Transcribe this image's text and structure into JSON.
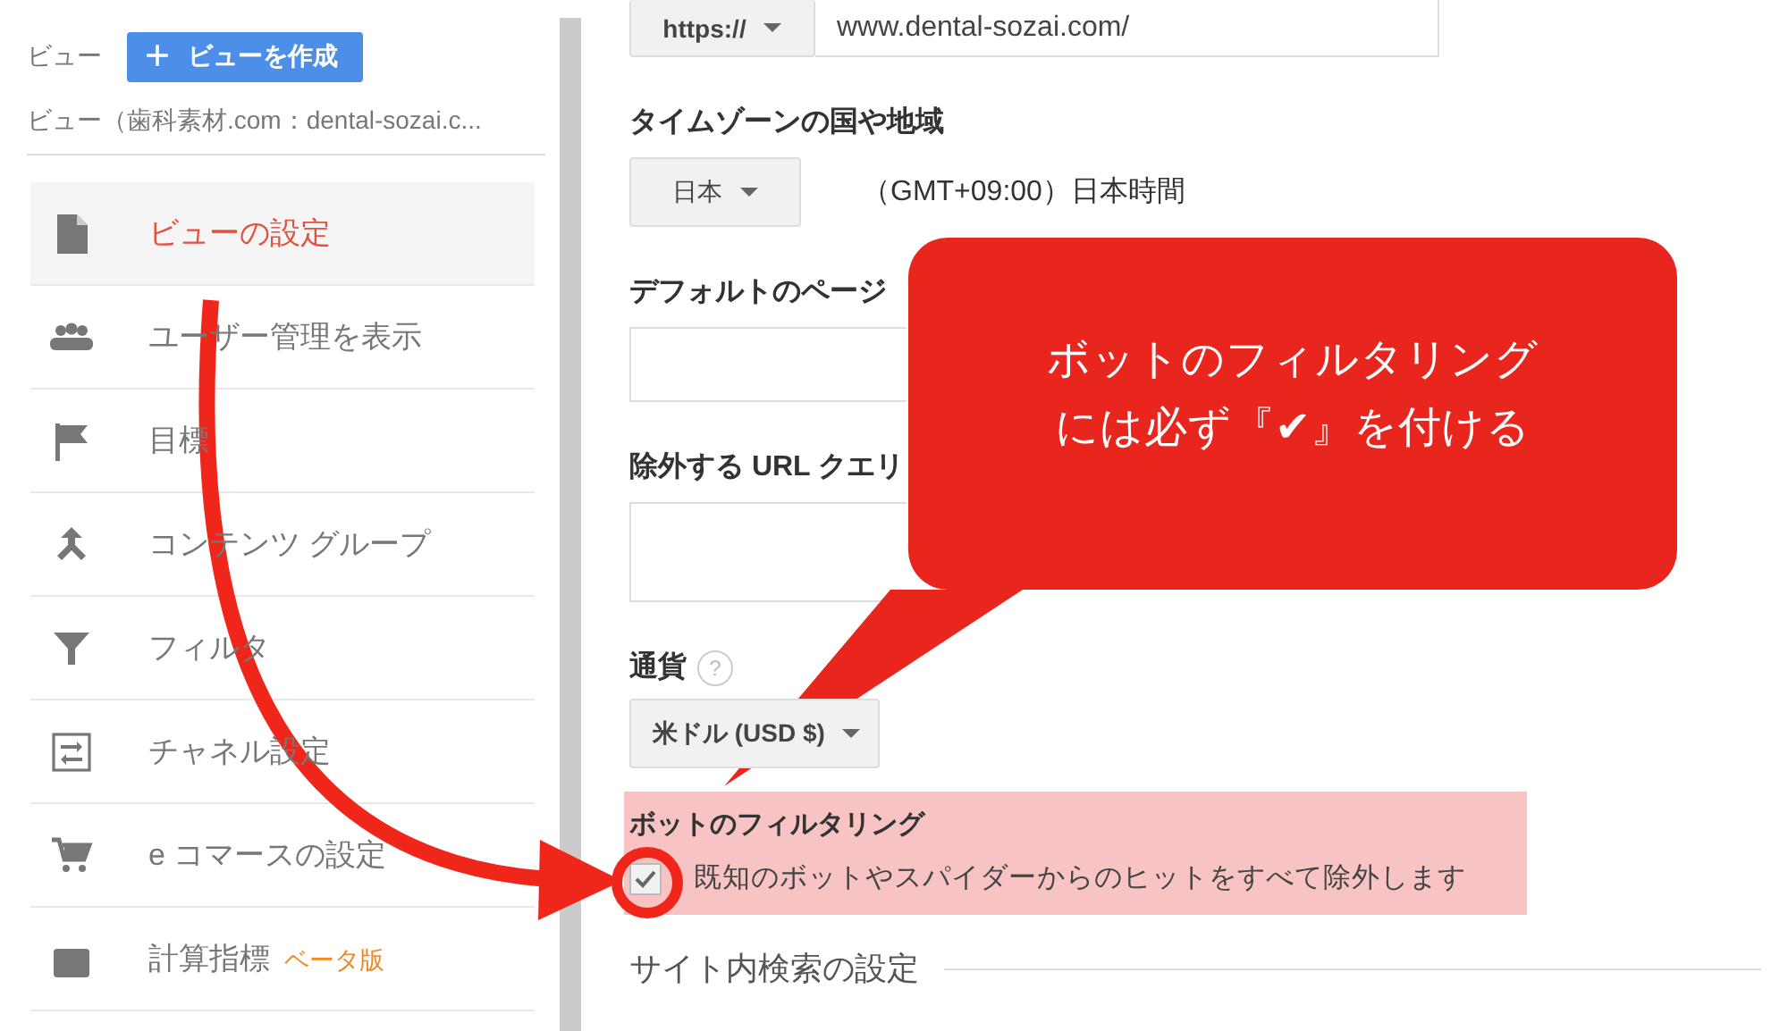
{
  "view_header": {
    "label": "ビュー",
    "create_button": {
      "icon_text": "+",
      "label": "ビューを作成"
    },
    "view_name": "ビュー（歯科素材.com：dental-sozai.c..."
  },
  "sidebar": {
    "items": [
      {
        "label": "ビューの設定",
        "selected": true
      },
      {
        "label": "ユーザー管理を表示",
        "selected": false
      },
      {
        "label": "目標",
        "selected": false
      },
      {
        "label": "コンテンツ グループ",
        "selected": false
      },
      {
        "label": "フィルタ",
        "selected": false
      },
      {
        "label": "チャネル設定",
        "selected": false
      },
      {
        "label": "e コマースの設定",
        "selected": false
      },
      {
        "label": "計算指標",
        "badge": "ベータ版",
        "selected": false
      }
    ]
  },
  "form": {
    "url": {
      "protocol": "https://",
      "value": "www.dental-sozai.com/"
    },
    "timezone": {
      "label": "タイムゾーンの国や地域",
      "country": "日本",
      "offset": "（GMT+09:00）日本時間"
    },
    "default_page": {
      "label": "デフォルトのページ"
    },
    "exclude_query": {
      "label": "除外する URL クエリ"
    },
    "currency": {
      "label": "通貨",
      "help": "?",
      "value": "米ドル (USD $)"
    },
    "bot_filtering": {
      "label": "ボットのフィルタリング",
      "option": "既知のボットやスパイダーからのヒットをすべて除外します",
      "checked": true
    },
    "site_search": {
      "heading": "サイト内検索の設定"
    }
  },
  "annotation": {
    "callout_lines": [
      "ボットのフィルタリング",
      "には必ず『✔』を付ける"
    ]
  }
}
